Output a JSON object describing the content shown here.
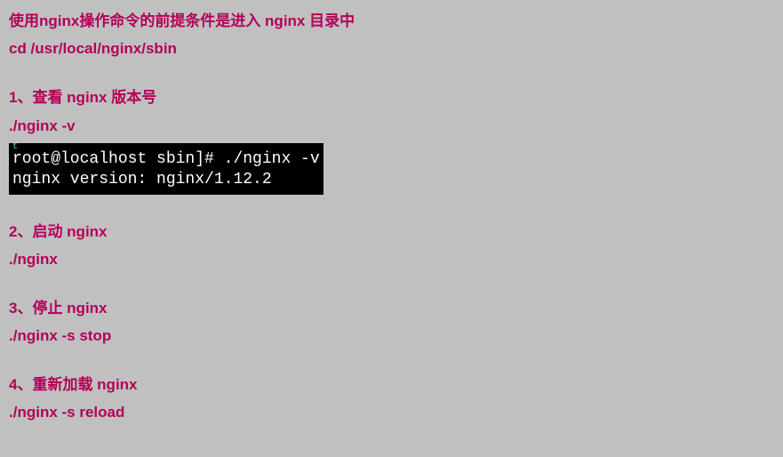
{
  "intro": {
    "prereq": "使用nginx操作命令的前提条件是进入 nginx 目录中",
    "cd_cmd": "cd    /usr/local/nginx/sbin"
  },
  "section1": {
    "title": "1、查看 nginx 版本号",
    "cmd": " ./nginx -v"
  },
  "terminal": {
    "top_fragment": "t",
    "line1": "root@localhost sbin]# ./nginx -v",
    "line2": "nginx version: nginx/1.12.2"
  },
  "section2": {
    "title": "2、启动 nginx",
    "cmd": " ./nginx"
  },
  "section3": {
    "title": "3、停止 nginx",
    "cmd": " ./nginx    -s    stop"
  },
  "section4": {
    "title": "4、重新加载 nginx",
    "cmd": " ./nginx -s reload"
  }
}
